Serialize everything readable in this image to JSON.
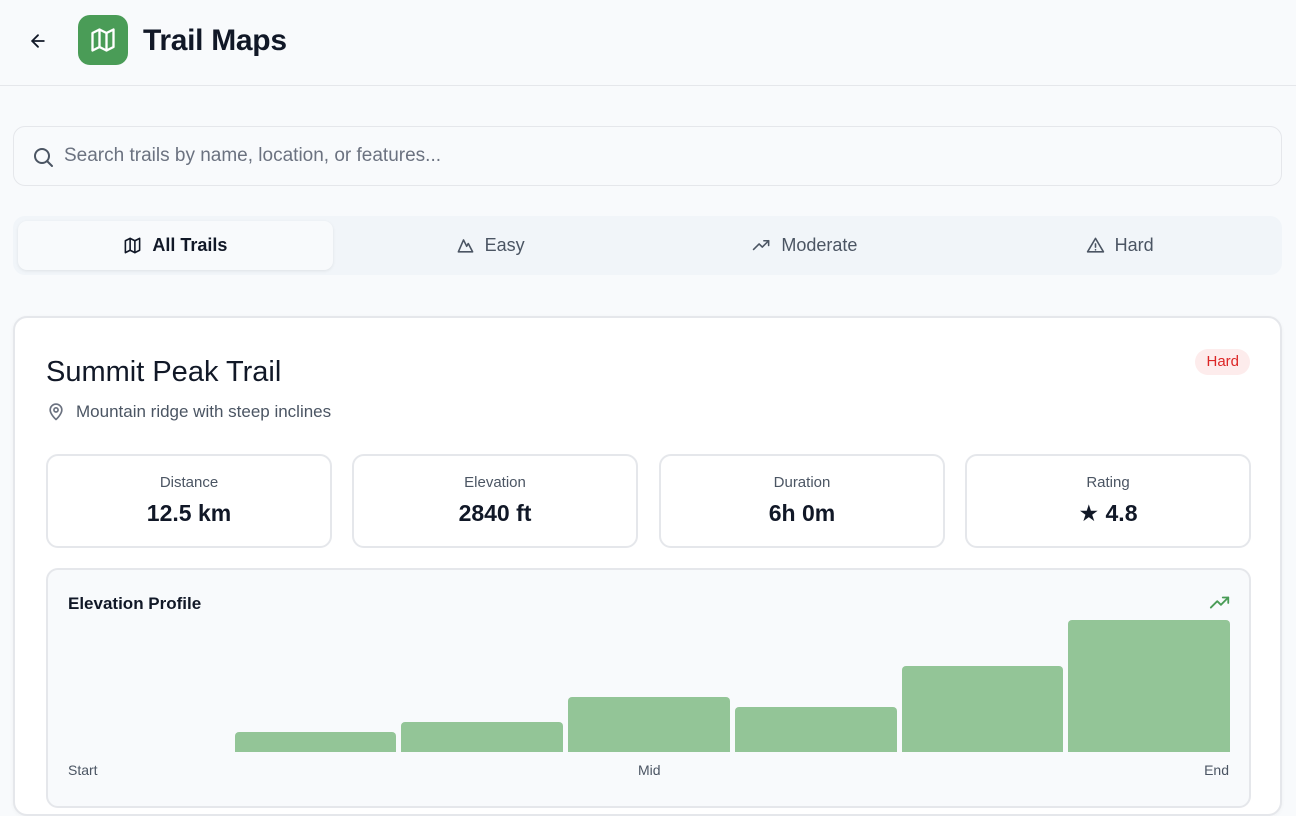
{
  "header": {
    "title": "Trail Maps",
    "logo_icon": "map-icon",
    "back_icon": "arrow-left-icon",
    "accent": "#4a9c57"
  },
  "search": {
    "placeholder": "Search trails by name, location, or features...",
    "value": "",
    "icon": "search-icon"
  },
  "tabs": [
    {
      "label": "All Trails",
      "icon": "map-icon",
      "active": true
    },
    {
      "label": "Easy",
      "icon": "mountain-icon",
      "active": false
    },
    {
      "label": "Moderate",
      "icon": "trending-up-icon",
      "active": false
    },
    {
      "label": "Hard",
      "icon": "alert-triangle-icon",
      "active": false
    }
  ],
  "trail": {
    "name": "Summit Peak Trail",
    "difficulty": "Hard",
    "difficulty_color": "#dc2626",
    "difficulty_bg": "#fdecec",
    "location": "Mountain ridge with steep inclines",
    "location_icon": "map-pin-icon",
    "stats": [
      {
        "label": "Distance",
        "value": "12.5 km"
      },
      {
        "label": "Elevation",
        "value": "2840 ft"
      },
      {
        "label": "Duration",
        "value": "6h 0m"
      },
      {
        "label": "Rating",
        "value": "★ 4.8"
      }
    ]
  },
  "elevation_profile": {
    "title": "Elevation Profile",
    "icon": "trending-up-icon",
    "bar_color": "#93c597",
    "x_labels": [
      "Start",
      "Mid",
      "End"
    ]
  },
  "chart_data": {
    "type": "bar",
    "title": "Elevation Profile",
    "categories": [
      "",
      "",
      "",
      "",
      "",
      "",
      ""
    ],
    "values": [
      0,
      15,
      23,
      42,
      34,
      65,
      100
    ],
    "ylim": [
      0,
      100
    ],
    "xlabel": "",
    "ylabel": "",
    "grid": false
  }
}
